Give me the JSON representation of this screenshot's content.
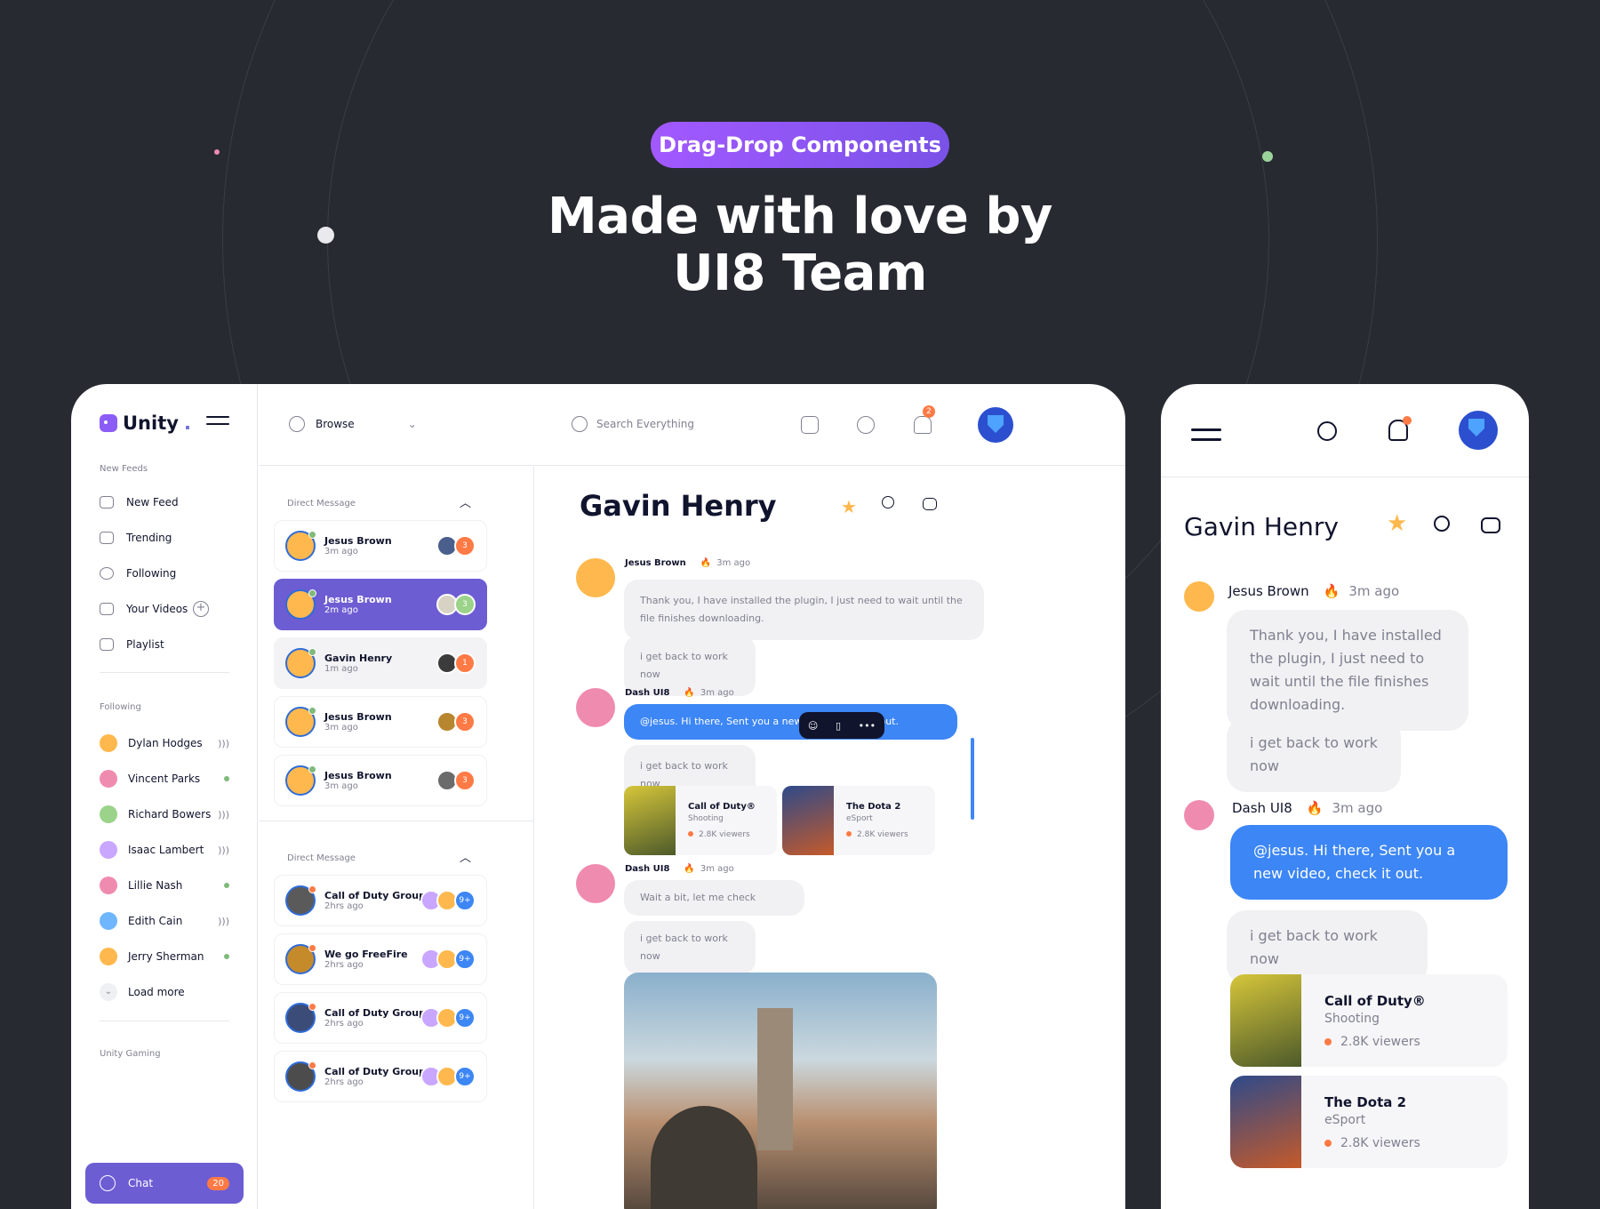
{
  "promo": {
    "pill": "Drag-Drop Components",
    "headline_line1": "Made with love by",
    "headline_line2": "UI8 Team"
  },
  "desktop": {
    "brand": "Unity",
    "brand_dot": ".",
    "sidebar": {
      "section_feeds": "New Feeds",
      "nav": [
        {
          "label": "New Feed",
          "icon": "gamepad-icon"
        },
        {
          "label": "Trending",
          "icon": "trend-icon"
        },
        {
          "label": "Following",
          "icon": "user-icon"
        },
        {
          "label": "Your Videos",
          "icon": "video-icon"
        },
        {
          "label": "Playlist",
          "icon": "list-icon"
        }
      ],
      "section_following": "Following",
      "following": [
        {
          "name": "Dylan Hodges",
          "status": "wifi"
        },
        {
          "name": "Vincent Parks",
          "status": "online"
        },
        {
          "name": "Richard Bowers",
          "status": "wifi"
        },
        {
          "name": "Isaac Lambert",
          "status": "wifi"
        },
        {
          "name": "Lillie Nash",
          "status": "online"
        },
        {
          "name": "Edith Cain",
          "status": "wifi"
        },
        {
          "name": "Jerry Sherman",
          "status": "online"
        }
      ],
      "load_more": "Load more",
      "section_gaming": "Unity Gaming",
      "chat_label": "Chat",
      "chat_badge": "20"
    },
    "topbar": {
      "browse": "Browse",
      "search_placeholder": "Search Everything",
      "notif_count": "2"
    },
    "dm1": {
      "label": "Direct Message",
      "items": [
        {
          "name": "Jesus Brown",
          "time": "3m ago",
          "count": "3"
        },
        {
          "name": "Jesus Brown",
          "time": "2m ago",
          "count": "3"
        },
        {
          "name": "Gavin Henry",
          "time": "1m ago",
          "count": "1"
        },
        {
          "name": "Jesus Brown",
          "time": "3m ago",
          "count": "3"
        },
        {
          "name": "Jesus Brown",
          "time": "3m ago",
          "count": "3"
        }
      ]
    },
    "dm2": {
      "label": "Direct Message",
      "items": [
        {
          "name": "Call of Duty Group",
          "time": "2hrs ago",
          "count": "9+"
        },
        {
          "name": "We go FreeFire",
          "time": "2hrs ago",
          "count": "9+"
        },
        {
          "name": "Call of Duty Group",
          "time": "2hrs ago",
          "count": "9+"
        },
        {
          "name": "Call of Duty Group",
          "time": "2hrs ago",
          "count": "9+"
        }
      ]
    },
    "chat": {
      "title": "Gavin Henry",
      "m1_name": "Jesus Brown",
      "m1_time": "3m ago",
      "m1_text": "Thank you, I have installed the plugin, I just need to wait until the file finishes downloading.",
      "m1_text2": "i get back to work now",
      "m2_name": "Dash UI8",
      "m2_time": "3m ago",
      "m2_text": "@jesus. Hi there, Sent you a new video, check it out.",
      "m2_text2": "i get back to work now",
      "games": [
        {
          "title": "Call of Duty®",
          "genre": "Shooting",
          "viewers": "2.8K viewers"
        },
        {
          "title": "The Dota 2",
          "genre": "eSport",
          "viewers": "2.8K viewers"
        }
      ],
      "m3_name": "Dash UI8",
      "m3_time": "3m ago",
      "m3_text": "Wait a bit, let me check",
      "m3_text2": "i get back to work now"
    }
  },
  "mobile": {
    "title": "Gavin Henry",
    "m1_name": "Jesus Brown",
    "m1_time": "3m ago",
    "m1_text": "Thank you, I have installed the plugin, I just need to wait until the file finishes downloading.",
    "m1_text2": "i get back to work now",
    "m2_name": "Dash UI8",
    "m2_time": "3m ago",
    "m2_text": "@jesus. Hi there, Sent you a new video, check it out.",
    "m2_text2": "i get back to work now",
    "games": [
      {
        "title": "Call of Duty®",
        "genre": "Shooting",
        "viewers": "2.8K viewers"
      },
      {
        "title": "The Dota 2",
        "genre": "eSport",
        "viewers": "2.8K viewers"
      }
    ]
  },
  "colors": {
    "accent": "#6c5dd3",
    "blue": "#3c86f5",
    "orange": "#ff7a45",
    "bg": "#272a31"
  }
}
